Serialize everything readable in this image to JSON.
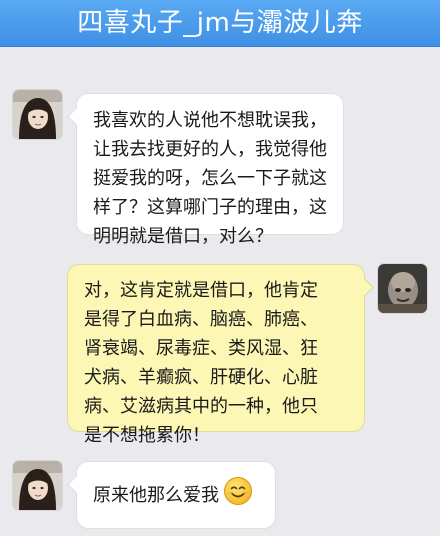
{
  "header": {
    "title": "四喜丸子_jm与灞波儿奔"
  },
  "messages": [
    {
      "side": "left",
      "lines": [
        "我喜欢的人说他不想耽误我，",
        "让我去找更好的人，我觉得他",
        "挺爱我的呀，怎么一下子就这",
        "样了？这算哪门子的理由，这",
        "明明就是借口，对么？"
      ]
    },
    {
      "side": "right",
      "lines": [
        "对，这肯定就是借口，他肯定",
        "是得了白血病、脑癌、肺癌、",
        "肾衰竭、尿毒症、类风湿、狂",
        "犬病、羊癫疯、肝硬化、心脏",
        "病、艾滋病其中的一种，他只",
        "是不想拖累你！"
      ]
    },
    {
      "side": "left",
      "lines": [
        "原来他那么爱我"
      ],
      "emoji": "smiling-face-icon"
    }
  ],
  "colors": {
    "header": "#4a9cf0",
    "background": "#e9e9ee",
    "left_bubble": "#ffffff",
    "right_bubble": "#fdf7b5"
  }
}
